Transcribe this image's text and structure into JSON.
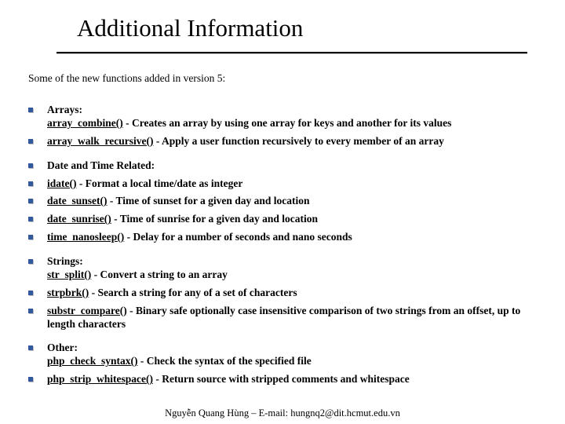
{
  "title": "Additional Information",
  "intro": "Some of the new functions added in version 5:",
  "groups": [
    {
      "heading": "Arrays:",
      "heading_inline": true,
      "items": [
        {
          "fn": "array_combine()",
          "desc": " - Creates an array by using one array for keys and another for its values"
        },
        {
          "fn": "array_walk_recursive()",
          "desc": " - Apply a user function recursively to every member of an array"
        }
      ]
    },
    {
      "heading": "Date and Time Related:",
      "heading_inline": false,
      "items": [
        {
          "fn": "idate()",
          "desc": " - Format a local time/date as integer"
        },
        {
          "fn": "date_sunset()",
          "desc": " - Time of sunset for a given day and location"
        },
        {
          "fn": "date_sunrise()",
          "desc": " - Time of sunrise for a given day and location"
        },
        {
          "fn": "time_nanosleep()",
          "desc": " - Delay for a number of seconds and nano seconds"
        }
      ]
    },
    {
      "heading": "Strings:",
      "heading_inline": true,
      "items": [
        {
          "fn": "str_split()",
          "desc": " - Convert a string to an array"
        },
        {
          "fn": "strpbrk()",
          "desc": " - Search a string for any of a set of characters"
        },
        {
          "fn": "substr_compare()",
          "desc": " - Binary safe optionally case insensitive comparison of two strings from an offset, up to length characters"
        }
      ]
    },
    {
      "heading": "Other:",
      "heading_inline": true,
      "items": [
        {
          "fn": "php_check_syntax()",
          "desc": " - Check the syntax of the specified file"
        },
        {
          "fn": "php_strip_whitespace()",
          "desc": " - Return source with stripped comments and whitespace"
        }
      ]
    }
  ],
  "footer": "Nguyễn Quang Hùng – E-mail: hungnq2@dit.hcmut.edu.vn"
}
